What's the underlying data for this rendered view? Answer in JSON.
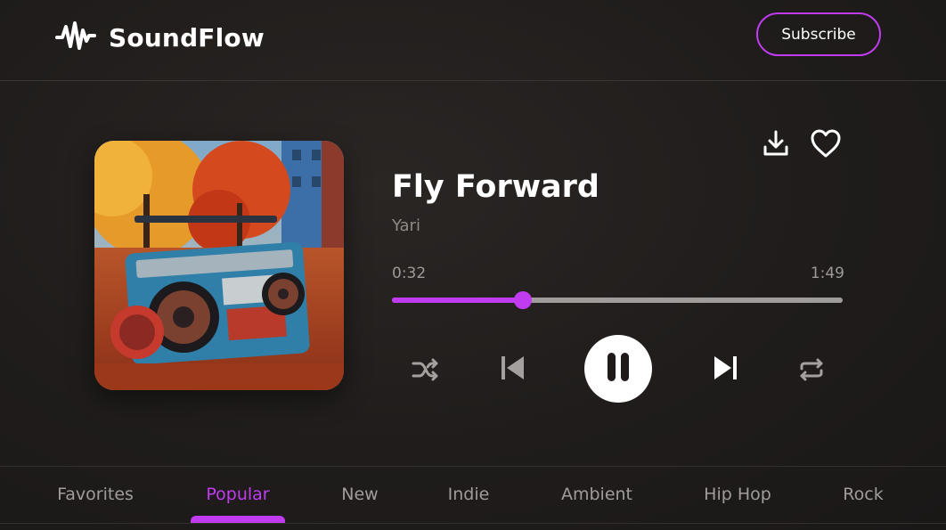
{
  "app": {
    "name": "SoundFlow"
  },
  "header": {
    "subscribe_label": "Subscribe"
  },
  "track": {
    "title": "Fly Forward",
    "artist": "Yari"
  },
  "playback": {
    "current_time": "0:32",
    "total_time": "1:49",
    "progress": 0.29,
    "state": "playing"
  },
  "icons": {
    "logo": "soundwave-icon",
    "download": "download-icon",
    "favorite": "heart-icon",
    "shuffle": "shuffle-icon",
    "previous": "skip-previous-icon",
    "pause": "pause-icon",
    "next": "skip-next-icon",
    "repeat": "repeat-icon"
  },
  "tabs": [
    {
      "label": "Favorites",
      "active": false
    },
    {
      "label": "Popular",
      "active": true
    },
    {
      "label": "New",
      "active": false
    },
    {
      "label": "Indie",
      "active": false
    },
    {
      "label": "Ambient",
      "active": false
    },
    {
      "label": "Hip Hop",
      "active": false
    },
    {
      "label": "Rock",
      "active": false
    }
  ],
  "colors": {
    "accent": "#c13cf0",
    "background": "#1f1c1b",
    "muted_text": "#a19c99"
  }
}
